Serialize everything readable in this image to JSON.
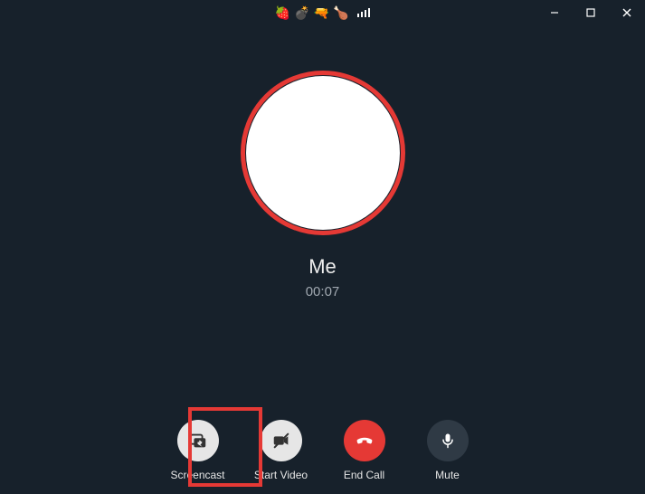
{
  "titlebar": {
    "emojis": [
      "🍓",
      "💣",
      "🔫",
      "🍗"
    ]
  },
  "call": {
    "name": "Me",
    "timer": "00:07"
  },
  "controls": {
    "screencast": "Screencast",
    "start_video": "Start Video",
    "end_call": "End Call",
    "mute": "Mute"
  },
  "colors": {
    "accent_red": "#e53935",
    "bg": "#17212b"
  }
}
